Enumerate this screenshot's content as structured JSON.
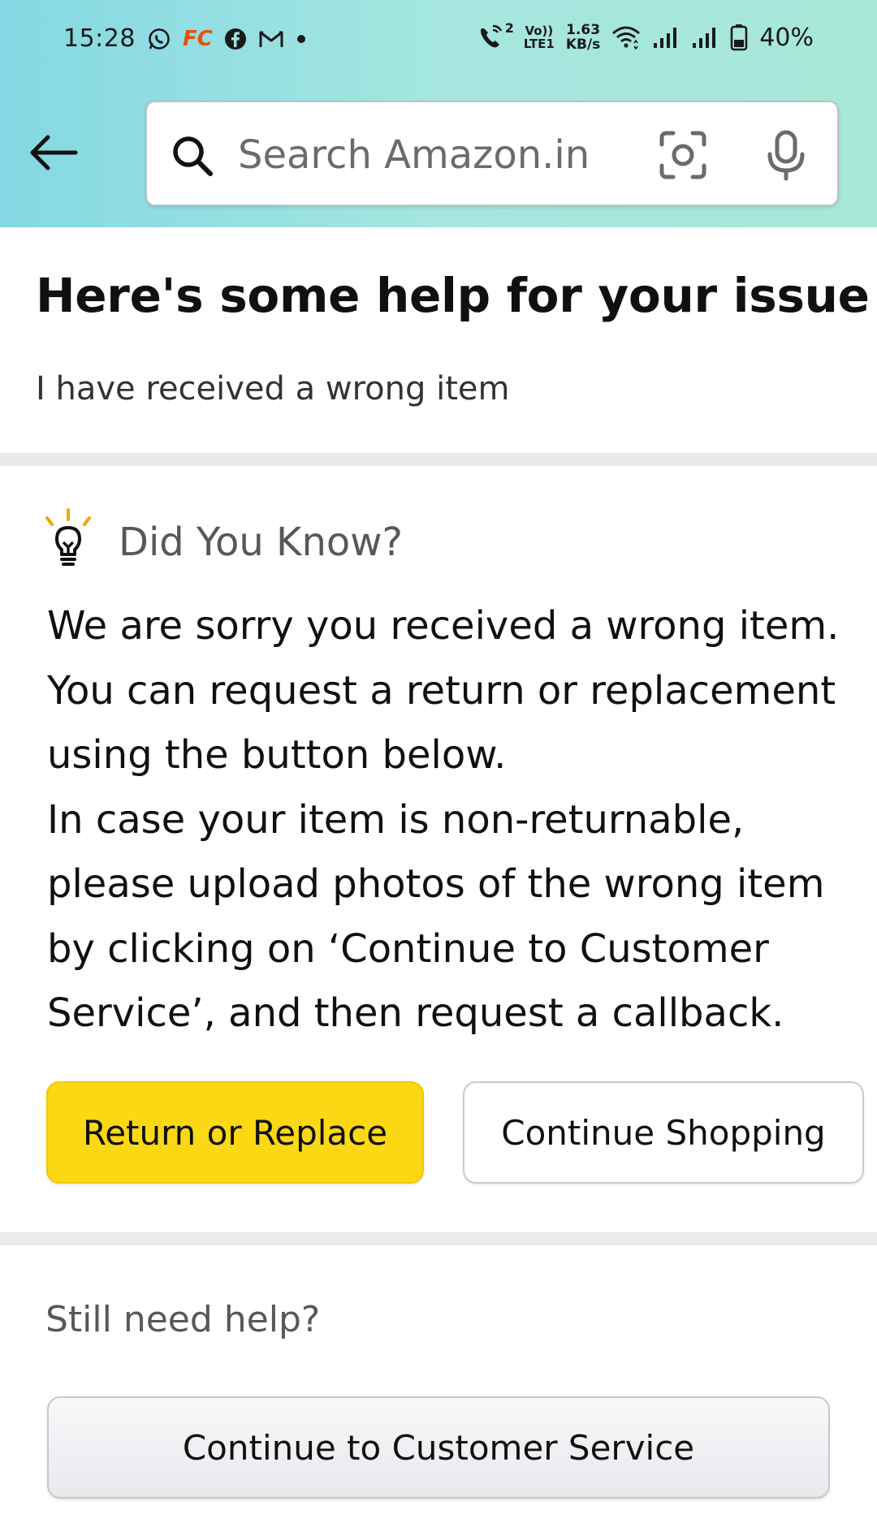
{
  "status_bar": {
    "time": "15:28",
    "app_icons": [
      "whatsapp-icon",
      "fc-badge",
      "facebook-icon",
      "gmail-icon",
      "dot"
    ],
    "fc_label": "FC",
    "volte_top": "Vo))",
    "volte_bottom": "LTE1",
    "call_sup": "2",
    "speed_value": "1.63",
    "speed_unit": "KB/s",
    "battery": "40%"
  },
  "header": {
    "search_placeholder": "Search Amazon.in",
    "gradient_colors": [
      "#84d8e3",
      "#a8e8d8"
    ]
  },
  "help": {
    "title": "Here's some help for your issue",
    "issue": "I have received a wrong item"
  },
  "did_you_know": {
    "heading": "Did You Know?",
    "paragraph1": "We are sorry you received a wrong item.\nYou can request a return or replacement\nusing the button below.",
    "paragraph2": "In case your item is non-returnable,\nplease upload photos of the wrong item\nby clicking on ‘Continue to Customer\nService’, and then request a callback."
  },
  "actions": {
    "return_replace": "Return or Replace",
    "continue_shopping": "Continue Shopping"
  },
  "still_need_help": {
    "label": "Still need help?",
    "customer_service": "Continue to Customer Service"
  },
  "colors": {
    "primary_button": "#fcd814",
    "divider": "#e9eaea",
    "bulb_accent": "#f0a800"
  }
}
